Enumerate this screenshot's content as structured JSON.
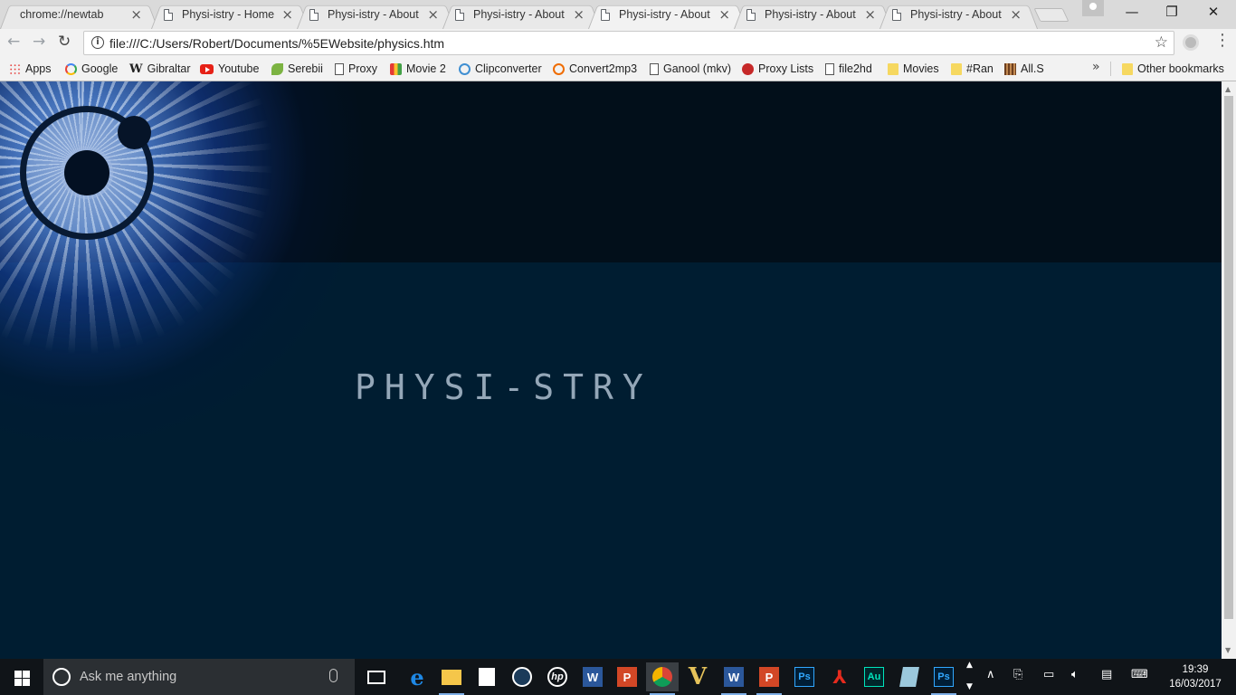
{
  "browser": {
    "tabs": [
      {
        "title": "chrome://newtab",
        "active": false,
        "icon": false
      },
      {
        "title": "Physi-istry - Home",
        "active": false,
        "icon": true
      },
      {
        "title": "Physi-istry - About",
        "active": false,
        "icon": true
      },
      {
        "title": "Physi-istry - About",
        "active": false,
        "icon": true
      },
      {
        "title": "Physi-istry - About",
        "active": true,
        "icon": true
      },
      {
        "title": "Physi-istry - About",
        "active": false,
        "icon": true
      },
      {
        "title": "Physi-istry - About",
        "active": false,
        "icon": true
      }
    ],
    "url": "file:///C:/Users/Robert/Documents/%5EWebsite/physics.htm",
    "bookmarks": [
      {
        "label": "Apps",
        "icon": "apps-grid-icon"
      },
      {
        "label": "Google",
        "icon": "google-icon"
      },
      {
        "label": "Gibraltar",
        "icon": "wikipedia-icon"
      },
      {
        "label": "Youtube",
        "icon": "youtube-icon"
      },
      {
        "label": "Serebii",
        "icon": "serebii-icon"
      },
      {
        "label": "Proxy",
        "icon": "page-icon"
      },
      {
        "label": "Movie 2",
        "icon": "movie-icon"
      },
      {
        "label": "Clipconverter",
        "icon": "clipconverter-icon"
      },
      {
        "label": "Convert2mp3",
        "icon": "convert2mp3-icon"
      },
      {
        "label": "Ganool (mkv)",
        "icon": "page-icon"
      },
      {
        "label": "Proxy Lists",
        "icon": "virgin-icon"
      },
      {
        "label": "file2hd",
        "icon": "page-icon"
      },
      {
        "label": "Movies",
        "icon": "folder-icon"
      },
      {
        "label": "#Ran",
        "icon": "folder-icon"
      },
      {
        "label": "All.S",
        "icon": "film-icon"
      }
    ],
    "other_bookmarks": "Other bookmarks",
    "more_glyph": "»"
  },
  "page": {
    "site_title": "Physi-stry"
  },
  "taskbar": {
    "search_placeholder": "Ask me anything",
    "apps": [
      {
        "name": "task-view",
        "label": ""
      },
      {
        "name": "edge",
        "label": "e"
      },
      {
        "name": "file-explorer",
        "label": ""
      },
      {
        "name": "store",
        "label": ""
      },
      {
        "name": "steam",
        "label": ""
      },
      {
        "name": "hp",
        "label": "hp"
      },
      {
        "name": "word",
        "label": "W"
      },
      {
        "name": "powerpoint",
        "label": "P"
      },
      {
        "name": "chrome",
        "label": ""
      },
      {
        "name": "vectorworks",
        "label": "V"
      },
      {
        "name": "word-2",
        "label": "W"
      },
      {
        "name": "powerpoint-2",
        "label": "P"
      },
      {
        "name": "photoshop",
        "label": "Ps"
      },
      {
        "name": "acrobat",
        "label": "⅄"
      },
      {
        "name": "audition",
        "label": "Au"
      },
      {
        "name": "notes",
        "label": ""
      },
      {
        "name": "photoshop-2",
        "label": "Ps"
      }
    ],
    "time": "19:39",
    "date": "16/03/2017"
  },
  "colors": {
    "page_background": "#001d31",
    "header_band": "#020f1a",
    "title_text": "#94a7b8"
  }
}
